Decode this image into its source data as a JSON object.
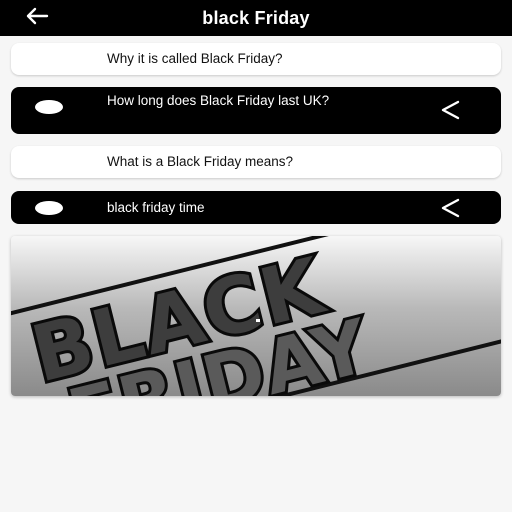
{
  "header": {
    "title": "black Friday",
    "back_icon": "arrow-left-icon"
  },
  "questions": [
    {
      "text": "Why it is called Black Friday?",
      "expanded": false
    },
    {
      "text": "How long does Black Friday last UK?",
      "expanded": true,
      "icon": "chevron-left-icon"
    },
    {
      "text": "What is a Black Friday means?",
      "expanded": false
    },
    {
      "text": "black friday time",
      "expanded": true,
      "icon": "chevron-left-icon"
    }
  ],
  "banner": {
    "line1": "BLACK",
    "line2": "FRIDAY"
  },
  "colors": {
    "bar": "#000000",
    "card": "#ffffff",
    "background": "#f6f6f6"
  }
}
